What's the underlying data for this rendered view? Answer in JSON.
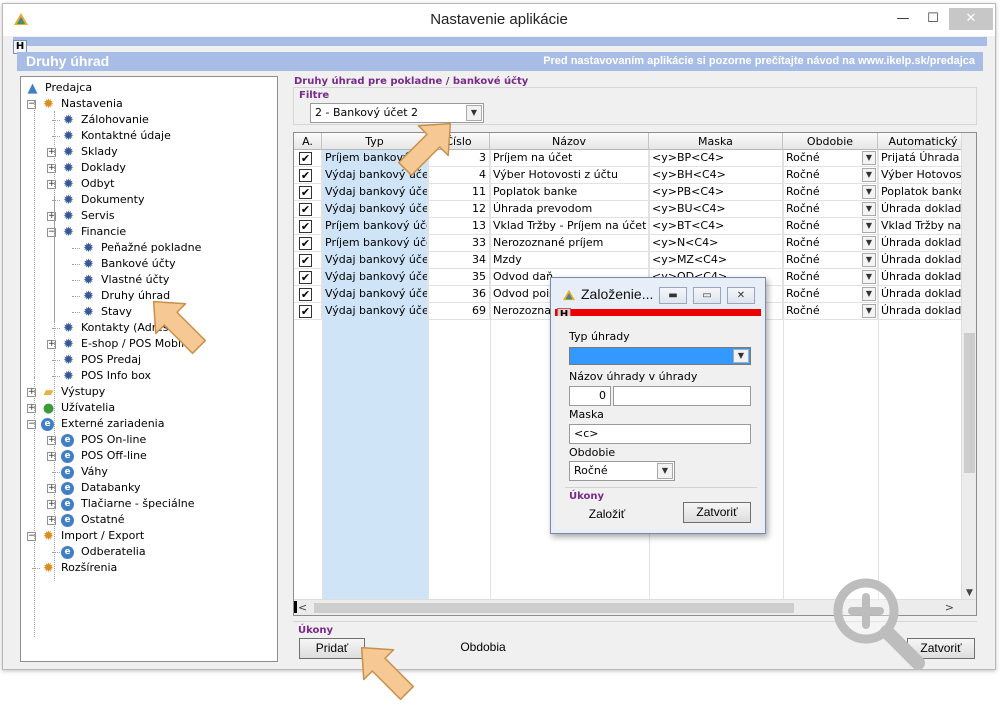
{
  "window": {
    "title": "Nastavenie aplikácie",
    "min_glyph": "—",
    "max_glyph": "☐",
    "close_glyph": "✕",
    "help_letter": "H"
  },
  "header": {
    "title": "Druhy úhrad",
    "note": "Pred nastavovaním aplikácie si pozorne prečítajte návod na www.ikelp.sk/predajca"
  },
  "tree": {
    "items": [
      {
        "label": "Predajca",
        "icon": "app-icon",
        "expander": ""
      },
      {
        "label": "Nastavenia",
        "icon": "gear-orange-icon",
        "expander": "−"
      },
      {
        "label": "Zálohovanie",
        "icon": "gear-blue-icon",
        "expander": ""
      },
      {
        "label": "Kontaktné údaje",
        "icon": "gear-blue-icon",
        "expander": ""
      },
      {
        "label": "Sklady",
        "icon": "gear-blue-icon",
        "expander": "+"
      },
      {
        "label": "Doklady",
        "icon": "gear-blue-icon",
        "expander": "+"
      },
      {
        "label": "Odbyt",
        "icon": "gear-blue-icon",
        "expander": "+"
      },
      {
        "label": "Dokumenty",
        "icon": "gear-blue-icon",
        "expander": ""
      },
      {
        "label": "Servis",
        "icon": "gear-blue-icon",
        "expander": "+"
      },
      {
        "label": "Financie",
        "icon": "gear-blue-icon",
        "expander": "−"
      },
      {
        "label": "Peňažné pokladne",
        "icon": "gear-blue-icon",
        "expander": ""
      },
      {
        "label": "Bankové účty",
        "icon": "gear-blue-icon",
        "expander": ""
      },
      {
        "label": "Vlastné účty",
        "icon": "gear-blue-icon",
        "expander": ""
      },
      {
        "label": "Druhy úhrad",
        "icon": "gear-blue-icon",
        "expander": ""
      },
      {
        "label": "Stavy",
        "icon": "gear-blue-icon",
        "expander": ""
      },
      {
        "label": "Kontakty (Adresár)",
        "icon": "gear-blue-icon",
        "expander": ""
      },
      {
        "label": "E-shop / POS Mobile",
        "icon": "gear-blue-icon",
        "expander": "+"
      },
      {
        "label": "POS Predaj",
        "icon": "gear-blue-icon",
        "expander": ""
      },
      {
        "label": "POS Info box",
        "icon": "gear-blue-icon",
        "expander": ""
      },
      {
        "label": "Výstupy",
        "icon": "folder-icon",
        "expander": "+"
      },
      {
        "label": "Užívatelia",
        "icon": "users-icon",
        "expander": "+"
      },
      {
        "label": "Externé zariadenia",
        "icon": "device-icon",
        "expander": "−"
      },
      {
        "label": "POS On-line",
        "icon": "device-icon",
        "expander": "+"
      },
      {
        "label": "POS Off-line",
        "icon": "device-icon",
        "expander": "+"
      },
      {
        "label": "Váhy",
        "icon": "device-icon",
        "expander": ""
      },
      {
        "label": "Databanky",
        "icon": "device-icon",
        "expander": "+"
      },
      {
        "label": "Tlačiarne - špeciálne",
        "icon": "device-icon",
        "expander": "+"
      },
      {
        "label": "Ostatné",
        "icon": "device-icon",
        "expander": "+"
      },
      {
        "label": "Import / Export",
        "icon": "gear-orange-icon",
        "expander": "−"
      },
      {
        "label": "Odberatelia",
        "icon": "device-icon",
        "expander": ""
      },
      {
        "label": "Rozšírenia",
        "icon": "gear-orange-icon",
        "expander": ""
      }
    ]
  },
  "section_title": "Druhy úhrad pre pokladne / bankové účty",
  "filter": {
    "label": "Filtre",
    "value": "2 - Bankový účet 2"
  },
  "grid": {
    "columns": [
      "A.",
      "Typ",
      "Číslo",
      "Názov",
      "Maska",
      "Obdobie",
      "Automatický text"
    ],
    "rows": [
      {
        "active": "✔",
        "typ": "Príjem bankový účet",
        "cislo": "3",
        "nazov": "Príjem na účet",
        "maska": "<y>BP<C4>",
        "obdobie": "Ročné",
        "auto": "Prijatá Úhrada do"
      },
      {
        "active": "✔",
        "typ": "Výdaj bankový účet",
        "cislo": "4",
        "nazov": "Výber Hotovosti z účtu",
        "maska": "<y>BH<C4>",
        "obdobie": "Ročné",
        "auto": "Výber Hotovosti"
      },
      {
        "active": "✔",
        "typ": "Výdaj bankový účet",
        "cislo": "11",
        "nazov": "Poplatok banke",
        "maska": "<y>PB<C4>",
        "obdobie": "Ročné",
        "auto": "Poplatok banke"
      },
      {
        "active": "✔",
        "typ": "Výdaj bankový účet",
        "cislo": "12",
        "nazov": "Úhrada prevodom",
        "maska": "<y>BU<C4>",
        "obdobie": "Ročné",
        "auto": "Úhrada dokladu č"
      },
      {
        "active": "✔",
        "typ": "Príjem bankový účet",
        "cislo": "13",
        "nazov": "Vklad Tržby - Príjem na účet",
        "maska": "<y>BT<C4>",
        "obdobie": "Ročné",
        "auto": "Vklad Tržby na ú"
      },
      {
        "active": "✔",
        "typ": "Príjem bankový účet",
        "cislo": "33",
        "nazov": "Nerozoznané príjem",
        "maska": "<y>N<C4>",
        "obdobie": "Ročné",
        "auto": "Úhrada dokladu č"
      },
      {
        "active": "✔",
        "typ": "Výdaj bankový účet",
        "cislo": "34",
        "nazov": "Mzdy",
        "maska": "<y>MZ<C4>",
        "obdobie": "Ročné",
        "auto": "Úhrada dokladu č"
      },
      {
        "active": "✔",
        "typ": "Výdaj bankový účet",
        "cislo": "35",
        "nazov": "Odvod daň",
        "maska": "<y>OD<C4>",
        "obdobie": "Ročné",
        "auto": "Úhrada dokladu č"
      },
      {
        "active": "✔",
        "typ": "Výdaj bankový účet",
        "cislo": "36",
        "nazov": "Odvod poisto",
        "maska": "",
        "obdobie": "Ročné",
        "auto": "Úhrada dokladu č"
      },
      {
        "active": "✔",
        "typ": "Výdaj bankový účet",
        "cislo": "69",
        "nazov": "Nerozoznané",
        "maska": "",
        "obdobie": "Ročné",
        "auto": "Úhrada dokladu č"
      }
    ]
  },
  "actions": {
    "label": "Úkony",
    "add": "Pridať",
    "obdobia": "Obdobia",
    "close": "Zatvoriť"
  },
  "dialog": {
    "title": "Založenie...",
    "help_letter": "H",
    "typ_label": "Typ úhrady",
    "typ_value": "",
    "nazov_label": "Názov úhrady v úhrady",
    "nazov_number": "0",
    "nazov_text": "",
    "maska_label": "Maska",
    "maska_value": "<c>",
    "obdobie_label": "Obdobie",
    "obdobie_value": "Ročné",
    "actions_label": "Úkony",
    "create": "Založiť",
    "close": "Zatvoriť"
  },
  "colors": {
    "header_bar": "#a8bde6",
    "typ_column": "#cfe5f7",
    "dialog_redbar": "#ee0000",
    "selection": "#3399ff",
    "label_purple": "#7a2a8a",
    "arrow": "#f6c994"
  }
}
